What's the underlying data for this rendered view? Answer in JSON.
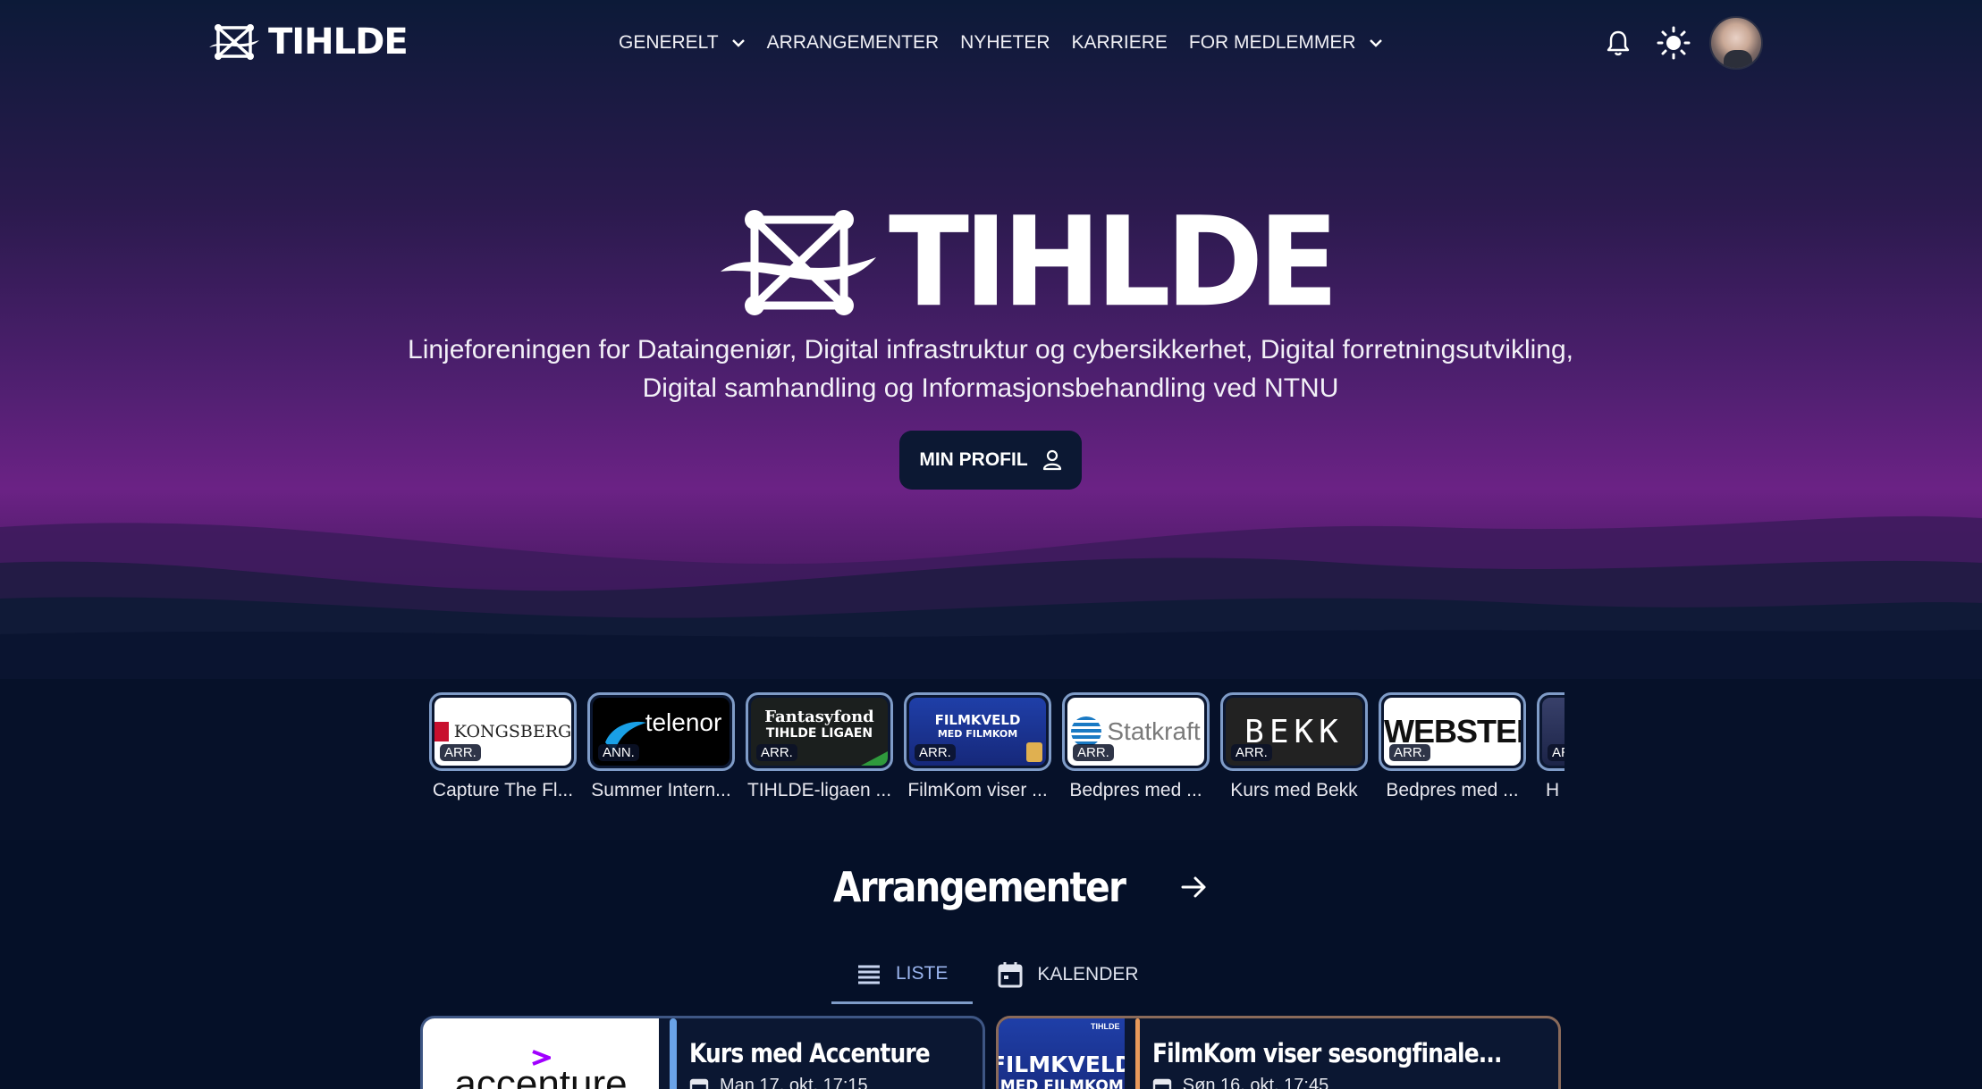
{
  "brand": {
    "name": "TIHLDE"
  },
  "nav": {
    "items": [
      {
        "label": "GENERELT",
        "dropdown": true
      },
      {
        "label": "ARRANGEMENTER",
        "dropdown": false
      },
      {
        "label": "NYHETER",
        "dropdown": false
      },
      {
        "label": "KARRIERE",
        "dropdown": false
      },
      {
        "label": "FOR MEDLEMMER",
        "dropdown": true
      }
    ],
    "icons": [
      "bell-icon",
      "sun-icon",
      "avatar"
    ]
  },
  "hero": {
    "title": "TIHLDE",
    "subtitle_line1": "Linjeforeningen for Dataingeniør, Digital infrastruktur og cybersikkerhet, Digital forretningsutvikling,",
    "subtitle_line2": "Digital samhandling og Informasjonsbehandling ved NTNU",
    "profile_button": "MIN PROFIL"
  },
  "stories": [
    {
      "label": "Capture The Fl...",
      "badge": "ARR.",
      "brand": "KONGSBERG"
    },
    {
      "label": "Summer Intern...",
      "badge": "ANN.",
      "brand": "telenor"
    },
    {
      "label": "TIHLDE-ligaen ...",
      "badge": "ARR.",
      "brand_top": "Fantasyfond",
      "brand_bottom": "TIHLDE LIGAEN"
    },
    {
      "label": "FilmKom viser ...",
      "badge": "ARR.",
      "brand_top": "FILMKVELD",
      "brand_bottom": "MED FILMKOM"
    },
    {
      "label": "Bedpres med ...",
      "badge": "ARR.",
      "brand": "Statkraft"
    },
    {
      "label": "Kurs med Bekk",
      "badge": "ARR.",
      "brand": "BEKK"
    },
    {
      "label": "Bedpres med ...",
      "badge": "ARR.",
      "brand": "WEBSTEP"
    },
    {
      "label": "H",
      "badge": "AR",
      "brand": ""
    }
  ],
  "events_section": {
    "title": "Arrangementer",
    "tabs": [
      {
        "label": "LISTE",
        "active": true
      },
      {
        "label": "KALENDER",
        "active": false
      }
    ],
    "cards": [
      {
        "title": "Kurs med Accenture",
        "date": "Man 17. okt. 17:15",
        "brand": "accenture",
        "accent": "#6aa3e8",
        "border": "#3e5684"
      },
      {
        "title": "FilmKom viser sesongfinale...",
        "date": "Søn 16. okt. 17:45",
        "brand_top": "FILMKVELD",
        "brand_bottom": "MED FILMKOM",
        "corner_tag": "TIHLDE",
        "accent": "#e8995a",
        "border": "#8a6a5a"
      }
    ]
  },
  "colors": {
    "background": "#061129",
    "hero_purple": "#6b2285",
    "accent_blue": "#7f9cc8"
  }
}
